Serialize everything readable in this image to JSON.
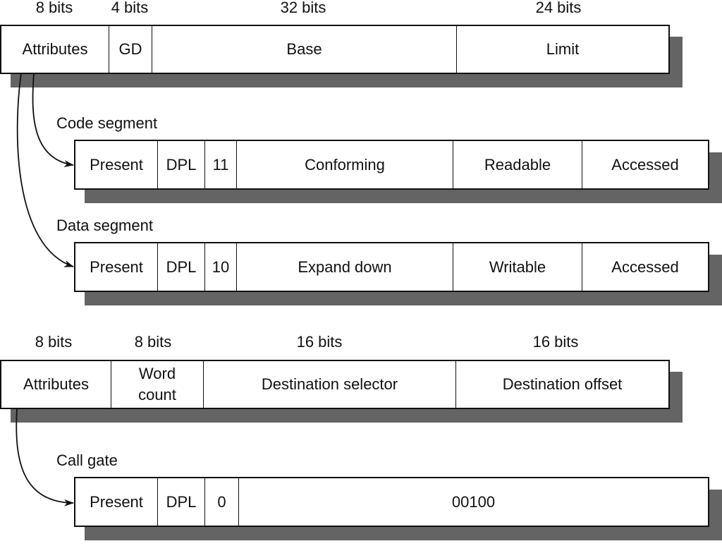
{
  "segment_descriptor": {
    "bit_labels": [
      "8 bits",
      "4 bits",
      "32 bits",
      "24 bits"
    ],
    "fields": [
      "Attributes",
      "GD",
      "Base",
      "Limit"
    ]
  },
  "code_segment": {
    "title": "Code segment",
    "fields": [
      "Present",
      "DPL",
      "11",
      "Conforming",
      "Readable",
      "Accessed"
    ]
  },
  "data_segment": {
    "title": "Data segment",
    "fields": [
      "Present",
      "DPL",
      "10",
      "Expand down",
      "Writable",
      "Accessed"
    ]
  },
  "gate_descriptor": {
    "bit_labels": [
      "8 bits",
      "8 bits",
      "16 bits",
      "16 bits"
    ],
    "fields": [
      "Attributes",
      "Word count",
      "Destination selector",
      "Destination offset"
    ],
    "word_count_lines": [
      "Word",
      "count"
    ]
  },
  "call_gate": {
    "title": "Call gate",
    "fields": [
      "Present",
      "DPL",
      "0",
      "00100"
    ]
  },
  "colors": {
    "shadow": "#646464",
    "border": "#111111",
    "background": "#ffffff"
  }
}
